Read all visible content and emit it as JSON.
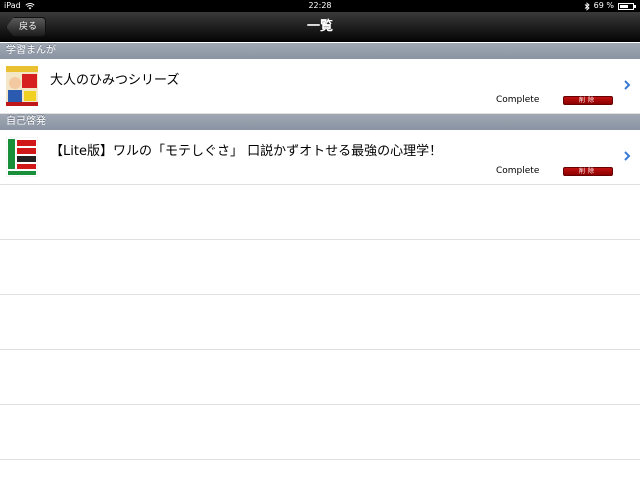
{
  "status_bar": {
    "device": "iPad",
    "time": "22:28",
    "battery": "69 %",
    "battery_level": 0.69
  },
  "nav": {
    "back_label": "戻る",
    "title": "一覧"
  },
  "sections": [
    {
      "header": "学習まんが",
      "items": [
        {
          "title": "大人のひみつシリーズ",
          "status": "Complete",
          "delete_label": "削除"
        }
      ]
    },
    {
      "header": "自己啓発",
      "items": [
        {
          "title": "【Lite版】ワルの「モテしぐさ」 口説かずオトせる最強の心理学！",
          "status": "Complete",
          "delete_label": "削除"
        }
      ]
    }
  ],
  "colors": {
    "section_header": "#8a93a2",
    "delete_button": "#b00000",
    "chevron": "#3a7bd5"
  }
}
